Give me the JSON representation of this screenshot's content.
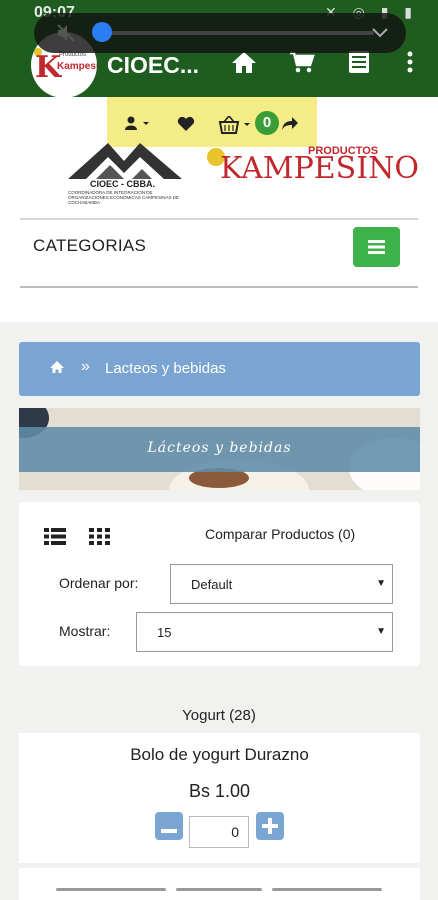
{
  "status_bar": {
    "time": "09:07"
  },
  "app_bar": {
    "title": "CIOEC..."
  },
  "app_logo": {
    "brand": "Kampesino",
    "brand_prefix": "Productos"
  },
  "user_toolbar": {
    "cart_count": "0"
  },
  "site_logo": {
    "cioec": "CIOEC - CBBA.",
    "cioec_sub": "COORDINADORA DE INTEGRACION DE ORGANIZACIONES ECONOMICAS CAMPESINAS DE COCHABAMBA",
    "brand_prefix": "PRODUCTOS",
    "brand": "KAMPESINO"
  },
  "categories": {
    "label": "CATEGORIAS"
  },
  "breadcrumb": {
    "separator": "»",
    "current": "Lacteos y bebidas"
  },
  "banner": {
    "title": "Lácteos y bebidas"
  },
  "filters": {
    "compare": "Comparar Productos (0)",
    "sort_label": "Ordenar por:",
    "sort_value": "Default",
    "show_label": "Mostrar:",
    "show_value": "15"
  },
  "category_heading": "Yogurt (28)",
  "products": [
    {
      "name": "Bolo de yogurt Durazno",
      "price": "Bs 1.00",
      "qty": "0"
    }
  ],
  "colors": {
    "app_bar": "#1e5c1f",
    "accent_green": "#3db14a",
    "breadcrumb_blue": "#7aa5d2",
    "toolbar_yellow": "#f4ec87",
    "brand_red": "#c0282d"
  }
}
